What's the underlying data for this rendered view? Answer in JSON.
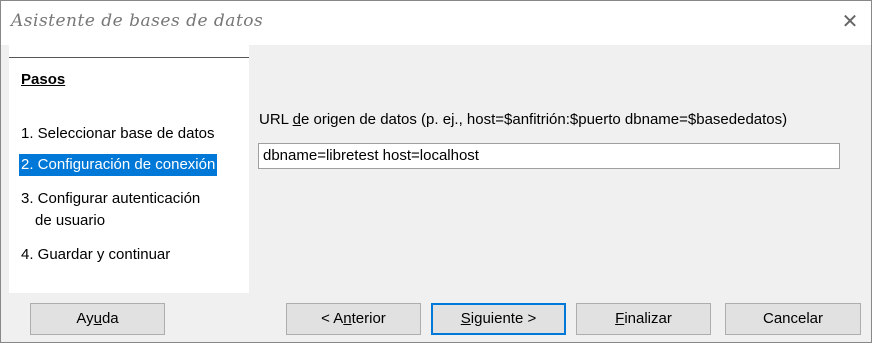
{
  "window": {
    "title": "Asistente de bases de datos",
    "close_glyph": "✕"
  },
  "steps": {
    "heading": "Pasos",
    "items": [
      {
        "label": "1. Seleccionar base de datos"
      },
      {
        "label": "2. Configuración de conexión",
        "active": true
      },
      {
        "label_line1": "3. Configurar autenticación",
        "label_line2": "de usuario"
      },
      {
        "label": "4. Guardar y continuar"
      }
    ]
  },
  "form": {
    "url_label_pre": "URL ",
    "url_label_mnemonic": "d",
    "url_label_post": "e origen de datos (p. ej., host=$anfitrión:$puerto dbname=$basededatos)",
    "url_value": "dbname=libretest host=localhost"
  },
  "buttons": {
    "help": {
      "pre": "Ay",
      "mn": "u",
      "post": "da"
    },
    "back": {
      "pre": "< A",
      "mn": "n",
      "post": "terior"
    },
    "next": {
      "pre": "",
      "mn": "S",
      "post": "iguiente >"
    },
    "finish": {
      "pre": "",
      "mn": "F",
      "post": "inalizar"
    },
    "cancel": {
      "label": "Cancelar"
    }
  }
}
